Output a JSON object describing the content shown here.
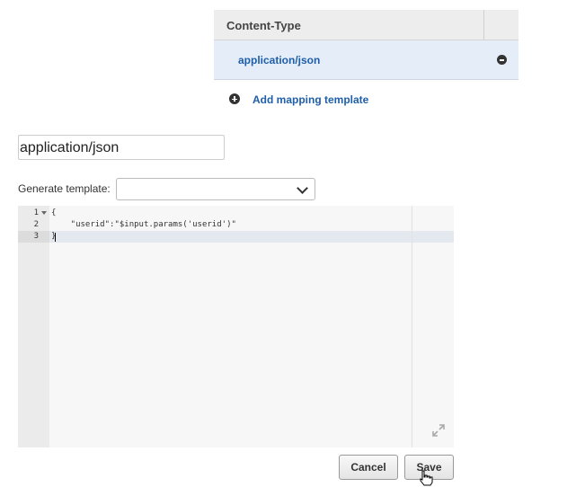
{
  "content_type_table": {
    "header": "Content-Type",
    "rows": [
      {
        "value": "application/json"
      }
    ],
    "add_label": "Add mapping template"
  },
  "template_form": {
    "content_type_value": "application/json",
    "generate_template_label": "Generate template:",
    "generate_template_selected": ""
  },
  "editor": {
    "line_numbers": [
      "1",
      "2",
      "3"
    ],
    "lines": [
      "{",
      "    \"userid\":\"$input.params('userid')\"",
      "}"
    ],
    "active_line": 3
  },
  "buttons": {
    "cancel": "Cancel",
    "save": "Save"
  },
  "icons": {
    "remove": "minus-circle-icon",
    "add": "plus-circle-icon",
    "dropdown": "chevron-down-icon",
    "expand": "expand-icon",
    "pointer": "hand-cursor-icon"
  },
  "colors": {
    "link": "#1f5ea8",
    "selected_row": "#e4edf8"
  }
}
